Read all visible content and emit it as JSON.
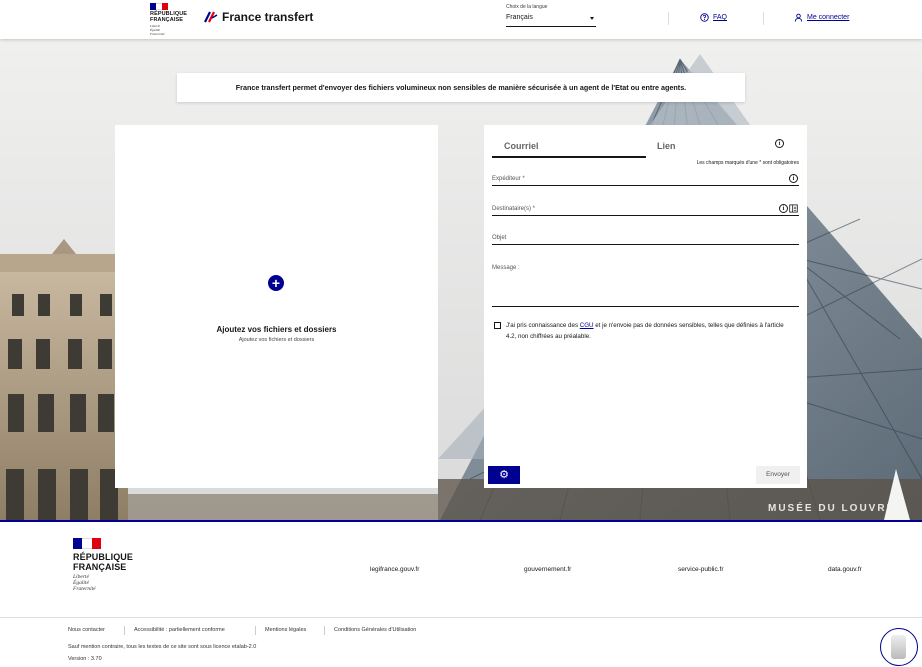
{
  "colors": {
    "primary": "#000091",
    "flag_blue": "#000091",
    "flag_white": "#ffffff",
    "flag_red": "#e1000f"
  },
  "header": {
    "rf_name_line1": "RÉPUBLIQUE",
    "rf_name_line2": "FRANÇAISE",
    "rf_motto_1": "Liberté",
    "rf_motto_2": "Égalité",
    "rf_motto_3": "Fraternité",
    "brand_name": "France transfert",
    "lang_label": "Choix de la langue",
    "lang_value": "Français",
    "faq_label": "FAQ",
    "faq_icon": "question-circle-icon",
    "login_label": "Me connecter",
    "login_icon": "user-icon"
  },
  "banner": {
    "text": "France transfert permet d'envoyer des fichiers volumineux non sensibles de manière sécurisée à un agent de l'Etat ou entre agents."
  },
  "upload": {
    "plus_icon": "plus-circle-icon",
    "title": "Ajoutez vos fichiers et dossiers",
    "subtitle": "Ajoutez vos fichiers et dossiers"
  },
  "form": {
    "tabs": [
      {
        "label": "Courriel"
      },
      {
        "label": "Lien"
      }
    ],
    "required_note": "Les champs marqués d'une * sont obligatoires",
    "sender_label": "Expéditeur *",
    "recipient_label": "Destinataire(s) *",
    "subject_label": "Objet",
    "message_label": "Message :",
    "consent_prefix": "J'ai pris connaissance des ",
    "consent_link": "CGU",
    "consent_suffix": " et je n'envoie pas de données sensibles, telles que définies à l'article 4.2, non chiffrées au préalable.",
    "settings_icon": "gear-icon",
    "send_label": "Envoyer"
  },
  "footer": {
    "rf_name_line1": "RÉPUBLIQUE",
    "rf_name_line2": "FRANÇAISE",
    "rf_motto_1": "Liberté",
    "rf_motto_2": "Égalité",
    "rf_motto_3": "Fraternité",
    "links": [
      "legifrance.gouv.fr",
      "gouvernement.fr",
      "service-public.fr",
      "data.gouv.fr"
    ],
    "bottom_links": [
      "Nous contacter",
      "Accessibilité : partiellement conforme",
      "Mentions légales",
      "Conditions Générales d'Utilisation"
    ],
    "licence": "Sauf mention contraire, tous les textes de ce site sont sous licence etalab-2.0",
    "version": "Version : 3.70"
  },
  "hero": {
    "sign_text": "MUSÉE DU LOUVRE"
  }
}
